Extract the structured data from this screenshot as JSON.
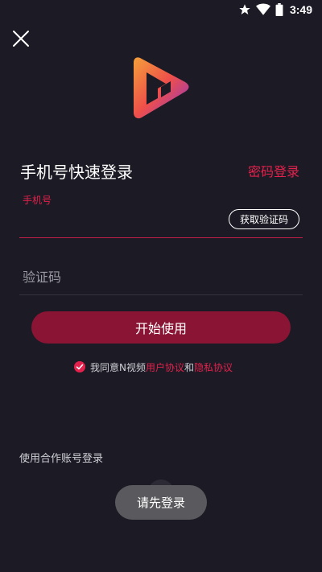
{
  "status_bar": {
    "time": "3:49",
    "icons": [
      "star-icon",
      "wifi-icon",
      "battery-icon"
    ]
  },
  "header": {
    "close_icon": "close-icon",
    "logo_icon": "app-logo-icon"
  },
  "login": {
    "title": "手机号快速登录",
    "password_login_label": "密码登录",
    "phone_label": "手机号",
    "phone_value": "",
    "get_code_label": "获取验证码",
    "code_placeholder": "验证码",
    "code_value": "",
    "start_button_label": "开始使用"
  },
  "agreement": {
    "checked": true,
    "prefix": "我同意N视频",
    "user_agreement": "用户协议",
    "conjunction": "和",
    "privacy_policy": "隐私协议"
  },
  "partner": {
    "label": "使用合作账号登录"
  },
  "toast": {
    "message": "请先登录"
  },
  "colors": {
    "background": "#1c1b25",
    "accent": "#e3214c",
    "button": "#8a1434",
    "toast": "#5a5a5e"
  }
}
